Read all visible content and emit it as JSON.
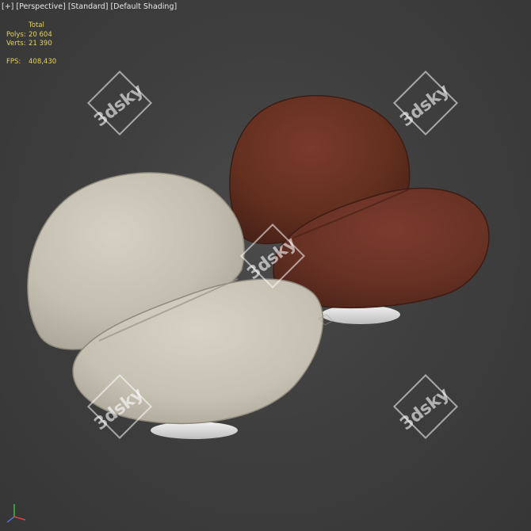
{
  "viewport": {
    "menu": {
      "plus": "[+]",
      "view": "[Perspective]",
      "quality": "[Standard]",
      "shading": "[Default Shading]"
    },
    "stats": {
      "header": "Total",
      "polys_label": "Polys:",
      "polys_value": "20 604",
      "verts_label": "Verts:",
      "verts_value": "21 390",
      "fps_label": "FPS:",
      "fps_value": "408,430"
    },
    "watermark_text": "3dsky",
    "colors": {
      "background": "#414141",
      "stats_text": "#e6d35a",
      "menu_text": "#e8e8e8",
      "chair_left": "#c9c3b7",
      "chair_right": "#6b3227"
    },
    "axis_gizmo": "xyz-axis-icon"
  }
}
